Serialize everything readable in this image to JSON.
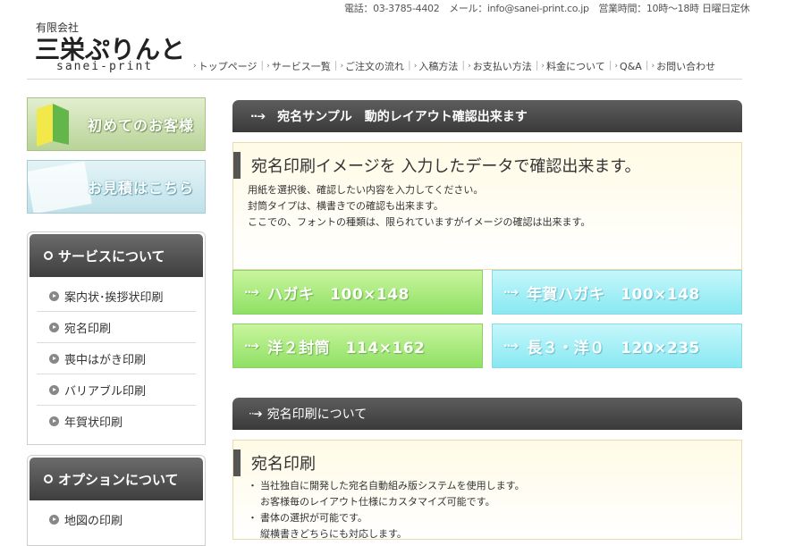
{
  "header": {
    "contact": "電話：03-3785-4402　メール：info@sanei-print.co.jp　営業時間：10時〜18時 日曜日定休",
    "company_type": "有限会社",
    "company_name": "三栄ぷりんと",
    "company_roman": "sanei-print",
    "nav": [
      {
        "label": "トップページ"
      },
      {
        "label": "サービス一覧"
      },
      {
        "label": "ご注文の流れ"
      },
      {
        "label": "入稿方法"
      },
      {
        "label": "お支払い方法"
      },
      {
        "label": "料金について"
      },
      {
        "label": "Q&A"
      },
      {
        "label": "お問い合わせ"
      }
    ]
  },
  "sidebar": {
    "banner_first": "初めてのお客様",
    "banner_estimate": "お見積はこちら",
    "service_heading": "サービスについて",
    "service_items": [
      {
        "label": "案内状･挨拶状印刷"
      },
      {
        "label": "宛名印刷"
      },
      {
        "label": "喪中はがき印刷"
      },
      {
        "label": "バリアブル印刷"
      },
      {
        "label": "年賀状印刷"
      }
    ],
    "option_heading": "オプションについて",
    "option_items": [
      {
        "label": "地図の印刷"
      }
    ]
  },
  "main": {
    "section1_heading": "宛名サンプル　動的レイアウト確認出来ます",
    "section1_title": "宛名印刷イメージを 入力したデータで確認出来ます。",
    "section1_lines": [
      "用紙を選択後、確認したい内容を入力してください。",
      "封筒タイプは、横書きでの確認も出来ます。",
      "ここでの、フォントの種類は、限られていますがイメージの確認は出来ます。"
    ],
    "size_buttons": [
      {
        "label": "ハガキ　100×148"
      },
      {
        "label": "年賀ハガキ　100×148"
      },
      {
        "label": "洋２封筒　114×162"
      },
      {
        "label": "長３・洋０　120×235"
      }
    ],
    "section2_heading": "宛名印刷について",
    "section2_title": "宛名印刷",
    "section2_bullets": [
      {
        "bullet": "・",
        "text": "当社独自に開発した宛名自動組み版システムを使用します。"
      },
      {
        "bullet": "",
        "text": "お客様毎のレイアウト仕様にカスタマイズ可能です。"
      },
      {
        "bullet": "・",
        "text": "書体の選択が可能です。"
      },
      {
        "bullet": "",
        "text": "縦横書きどちらにも対応します。"
      }
    ]
  },
  "colors": {
    "section_head": "#4a4a4a",
    "panel_bg": "#fffbe6",
    "button_green": "#a8e67c",
    "button_cyan": "#a6eef6"
  }
}
